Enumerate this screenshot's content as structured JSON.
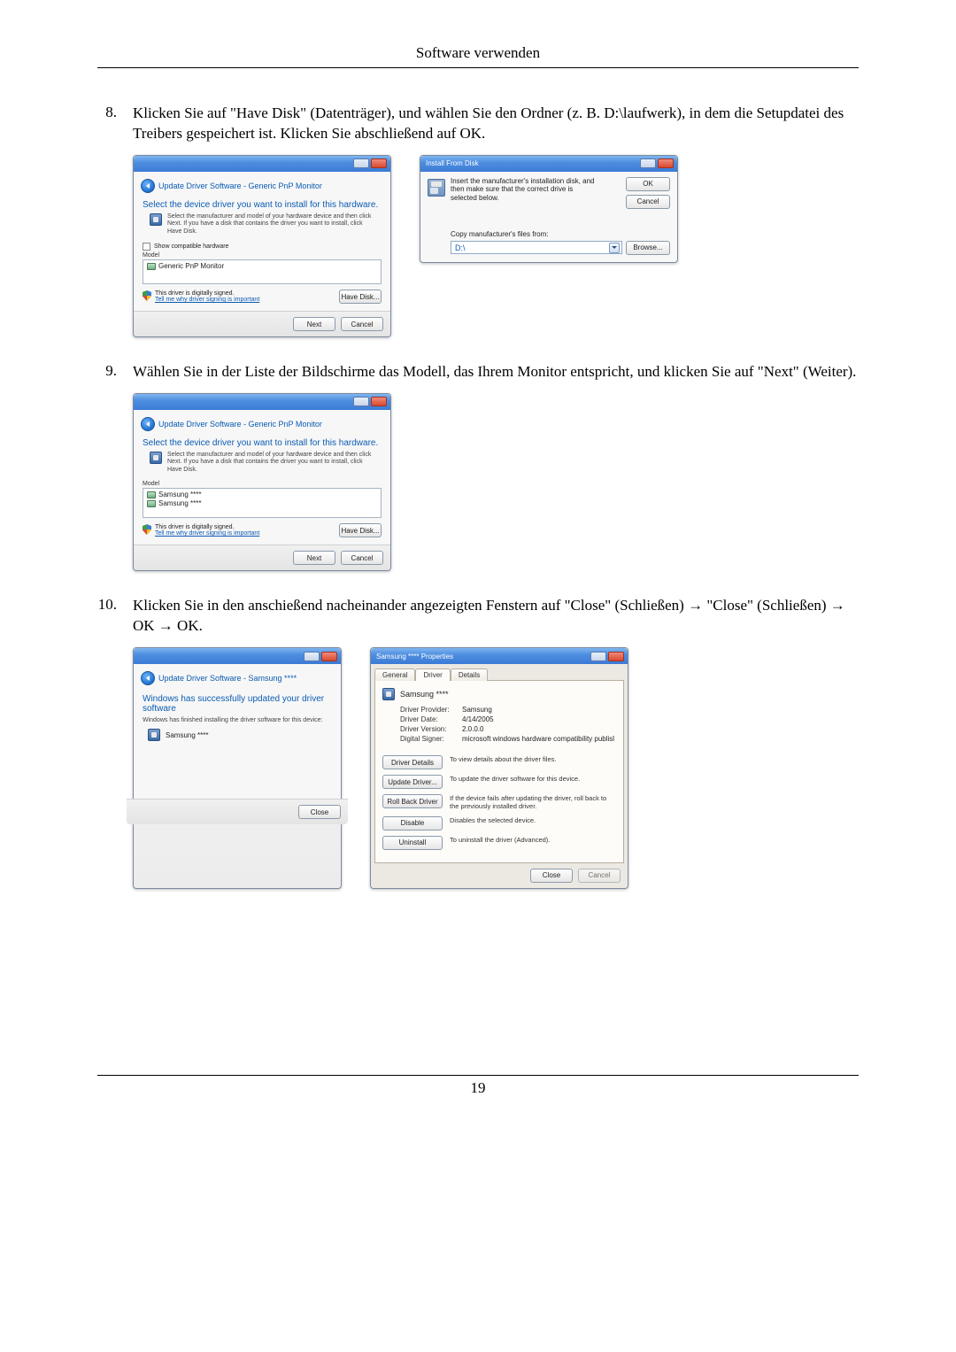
{
  "header": {
    "title": "Software verwenden"
  },
  "page_number": "19",
  "steps": {
    "s8": {
      "num": "8.",
      "text": "Klicken Sie auf \"Have Disk\" (Datenträger), und wählen Sie den Ordner (z. B. D:\\laufwerk), in dem die Setupdatei des Treibers gespeichert ist. Klicken Sie abschließend auf OK."
    },
    "s9": {
      "num": "9.",
      "text": "Wählen Sie in der Liste der Bildschirme das Modell, das Ihrem Monitor entspricht, und klicken Sie auf \"Next\" (Weiter)."
    },
    "s10": {
      "num": "10.",
      "text": "Klicken Sie in den anschießend nacheinander angezeigten Fenstern auf \"Close\" (Schließen) → \"Close\" (Schließen) → OK → OK."
    }
  },
  "dlg_update1": {
    "crumb": "Update Driver Software - Generic PnP Monitor",
    "heading": "Select the device driver you want to install for this hardware.",
    "instr": "Select the manufacturer and model of your hardware device and then click Next. If you have a disk that contains the driver you want to install, click Have Disk.",
    "compat_label": "Show compatible hardware",
    "model_hdr": "Model",
    "list_item": "Generic PnP Monitor",
    "signed": "This driver is digitally signed.",
    "signed_link": "Tell me why driver signing is important",
    "have_disk": "Have Disk...",
    "next": "Next",
    "cancel": "Cancel"
  },
  "dlg_ifd": {
    "title": "Install From Disk",
    "msg": "Insert the manufacturer's installation disk, and then make sure that the correct drive is selected below.",
    "ok": "OK",
    "cancel": "Cancel",
    "copy_label": "Copy manufacturer's files from:",
    "path_value": "D:\\",
    "browse": "Browse..."
  },
  "dlg_update2": {
    "crumb": "Update Driver Software - Generic PnP Monitor",
    "heading": "Select the device driver you want to install for this hardware.",
    "instr": "Select the manufacturer and model of your hardware device and then click Next. If you have a disk that contains the driver you want to install, click Have Disk.",
    "model_hdr": "Model",
    "list_item1": "Samsung ****",
    "list_item2": "Samsung ****",
    "signed": "This driver is digitally signed.",
    "signed_link": "Tell me why driver signing is important",
    "have_disk": "Have Disk...",
    "next": "Next",
    "cancel": "Cancel"
  },
  "dlg_success": {
    "crumb": "Update Driver Software - Samsung ****",
    "heading": "Windows has successfully updated your driver software",
    "sub": "Windows has finished installing the driver software for this device:",
    "device": "Samsung ****",
    "close": "Close"
  },
  "dlg_props": {
    "title": "Samsung **** Properties",
    "tabs": {
      "general": "General",
      "driver": "Driver",
      "details": "Details"
    },
    "device": "Samsung ****",
    "provider_k": "Driver Provider:",
    "provider_v": "Samsung",
    "date_k": "Driver Date:",
    "date_v": "4/14/2005",
    "version_k": "Driver Version:",
    "version_v": "2.0.0.0",
    "signer_k": "Digital Signer:",
    "signer_v": "microsoft windows hardware compatibility publisl",
    "btn_details": "Driver Details",
    "desc_details": "To view details about the driver files.",
    "btn_update": "Update Driver...",
    "desc_update": "To update the driver software for this device.",
    "btn_rollback": "Roll Back Driver",
    "desc_rollback": "If the device fails after updating the driver, roll back to the previously installed driver.",
    "btn_disable": "Disable",
    "desc_disable": "Disables the selected device.",
    "btn_uninstall": "Uninstall",
    "desc_uninstall": "To uninstall the driver (Advanced).",
    "close": "Close",
    "cancel": "Cancel"
  }
}
